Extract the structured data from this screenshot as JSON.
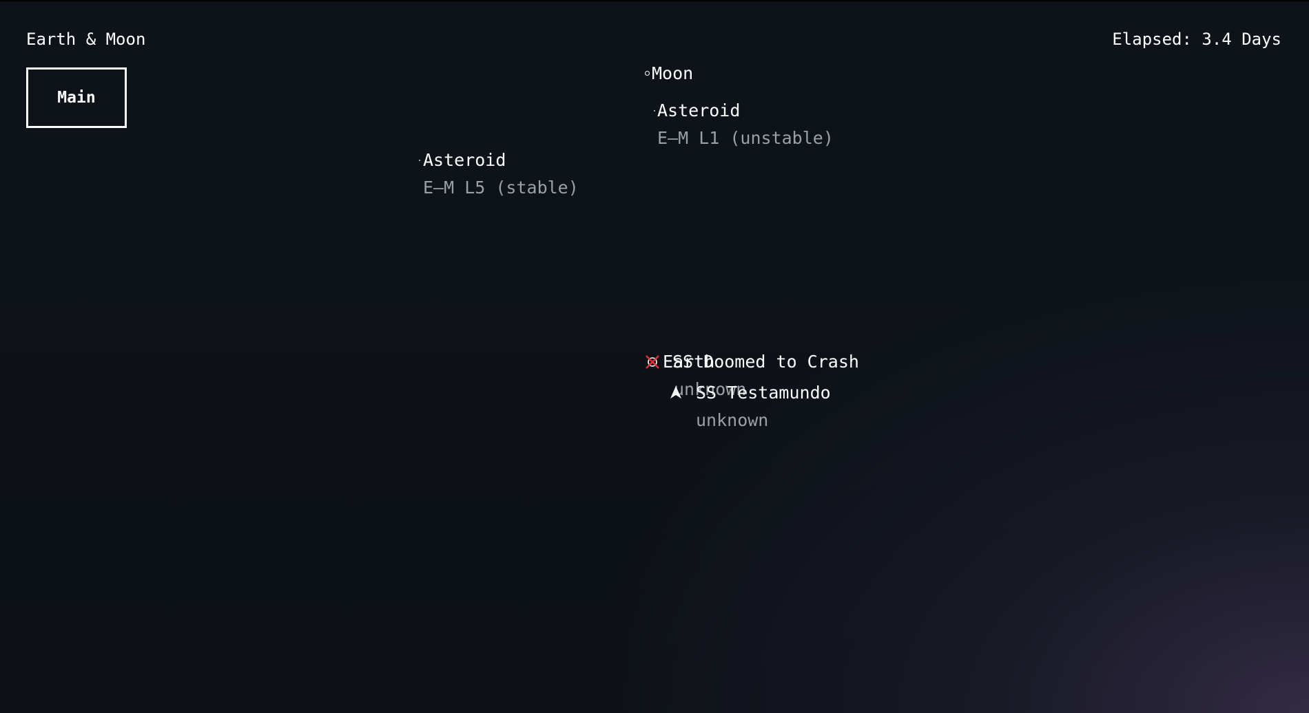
{
  "hud": {
    "title": "Earth & Moon",
    "elapsed": "Elapsed: 3.4 Days",
    "main_button": "Main"
  },
  "bodies": {
    "moon": {
      "name": "Moon"
    },
    "asteroid_l1": {
      "name": "Asteroid",
      "sub": "E–M L1 (unstable)"
    },
    "asteroid_l5": {
      "name": "Asteroid",
      "sub": "E–M L5 (stable)"
    },
    "earth": {
      "name": "Earth",
      "sub": "unknown"
    },
    "ship_doomed": {
      "name": "SS Doomed to Crash"
    },
    "ship_testamundo": {
      "name": "SS Testamundo",
      "sub": "unknown"
    }
  },
  "icons": {
    "moon": "moon-dot-icon",
    "asteroid": "asteroid-dot-icon",
    "crash": "crash-marker-icon",
    "ship": "ship-arrow-icon"
  },
  "colors": {
    "background": "#0d1117",
    "text": "#ffffff",
    "subtext": "#9aa0a6",
    "crash": "#e03131"
  }
}
